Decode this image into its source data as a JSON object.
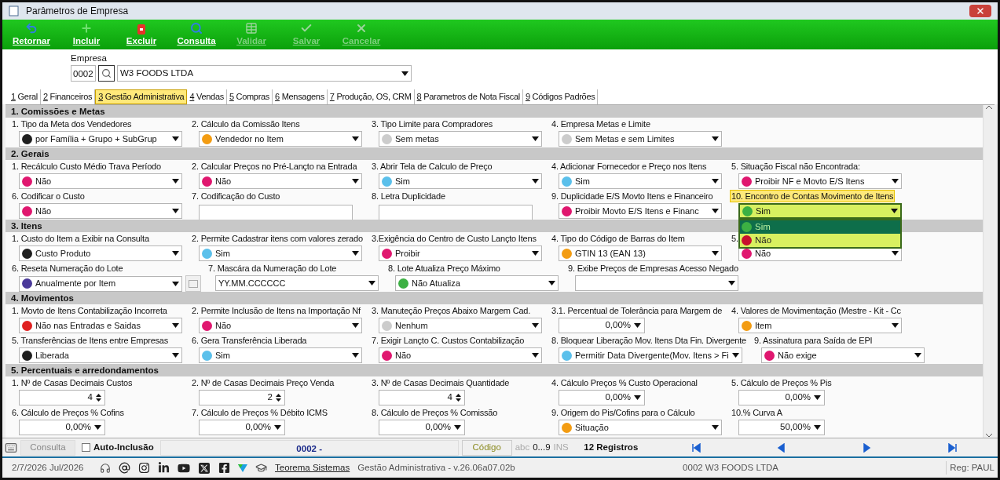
{
  "window": {
    "title": "Parâmetros de Empresa"
  },
  "toolbar": [
    {
      "label": "Retornar",
      "disabled": false
    },
    {
      "label": "Incluir",
      "disabled": false
    },
    {
      "label": "Excluir",
      "disabled": false
    },
    {
      "label": "Consulta",
      "disabled": false
    },
    {
      "label": "Validar",
      "disabled": true
    },
    {
      "label": "Salvar",
      "disabled": true
    },
    {
      "label": "Cancelar",
      "disabled": true
    }
  ],
  "empresa": {
    "label": "Empresa",
    "code": "0002",
    "name": "W3 FOODS LTDA"
  },
  "tabs": [
    {
      "key": "1",
      "label": "Geral",
      "selected": false
    },
    {
      "key": "2",
      "label": "Financeiros",
      "selected": false
    },
    {
      "key": "3",
      "label": "Gestão Administrativa",
      "selected": true
    },
    {
      "key": "4",
      "label": "Vendas",
      "selected": false
    },
    {
      "key": "5",
      "label": "Compras",
      "selected": false
    },
    {
      "key": "6",
      "label": "Mensagens",
      "selected": false
    },
    {
      "key": "7",
      "label": "Produção, OS, CRM",
      "selected": false
    },
    {
      "key": "8",
      "label": "Parametros de Nota Fiscal",
      "selected": false
    },
    {
      "key": "9",
      "label": "Códigos Padrões",
      "selected": false
    }
  ],
  "sections": [
    {
      "title": "1.  Comissões e Metas",
      "rows": [
        [
          {
            "label": "1. Tipo da Meta dos Vendedores",
            "kind": "combo",
            "value": "por Família + Grupo + SubGrup",
            "color": "#1f1f1f"
          },
          {
            "label": "2. Cálculo da Comissão Itens",
            "kind": "combo",
            "value": "Vendedor no Item",
            "color": "#f39c12"
          },
          {
            "label": "3. Tipo Limite para Compradores",
            "kind": "combo",
            "value": "Sem metas",
            "color": "#cccccc"
          },
          {
            "label": "4. Empresa Metas e Limite",
            "kind": "combo",
            "value": "Sem Metas e sem Limites",
            "color": "#cccccc"
          }
        ]
      ]
    },
    {
      "title": "2. Gerais",
      "rows": [
        [
          {
            "label": "1. Recálculo Custo Médio Trava Período",
            "kind": "combo",
            "value": "Não",
            "color": "#e0176f"
          },
          {
            "label": "2. Calcular Preços no Pré-Lançto na Entrada",
            "kind": "combo",
            "value": "Não",
            "color": "#e0176f"
          },
          {
            "label": "3. Abrir Tela de Calculo de Preço",
            "kind": "combo",
            "value": "Sim",
            "color": "#5bc0eb"
          },
          {
            "label": "4. Adicionar Fornecedor e Preço nos Itens",
            "kind": "combo",
            "value": "Sim",
            "color": "#5bc0eb"
          },
          {
            "label": "5. Situação Fiscal não Encontrada:",
            "kind": "combo",
            "value": "Proibir NF e Movto E/S Itens",
            "color": "#e0176f"
          }
        ],
        [
          {
            "label": "6. Codificar o Custo",
            "kind": "combo",
            "value": "Não",
            "color": "#e0176f"
          },
          {
            "label": "7. Codificação do Custo",
            "kind": "text"
          },
          {
            "label": "8. Letra Duplicidade",
            "kind": "text"
          },
          {
            "label": "9. Duplicidade E/S Movto Itens e Financeiro",
            "kind": "combo",
            "value": "Proibir Movto E/S Itens e Financ",
            "color": "#e0176f"
          },
          {
            "label": "10. Encontro de Contas Movimento de Itens",
            "kind": "combo",
            "value": "Sim",
            "color": "#3cb043",
            "highlighted": true,
            "open": true,
            "options": [
              {
                "label": "Sim",
                "color": "#3cb043",
                "selected": true
              },
              {
                "label": "Não",
                "color": "#c8102e",
                "selected": false
              }
            ]
          }
        ]
      ]
    },
    {
      "title": "3. Itens",
      "rows": [
        [
          {
            "label": "1. Custo do Item a Exibir na Consulta",
            "kind": "combo",
            "value": "Custo Produto",
            "color": "#1f1f1f"
          },
          {
            "label": "2. Permite Cadastrar itens com valores zerado",
            "kind": "combo",
            "value": "Sim",
            "color": "#5bc0eb"
          },
          {
            "label": "3.Exigência do Centro de Custo Lançto Itens",
            "kind": "combo",
            "value": "Proibir",
            "color": "#e0176f"
          },
          {
            "label": "4. Tipo do Código de Barras do Item",
            "kind": "combo",
            "value": "GTIN 13 (EAN 13)",
            "color": "#f39c12"
          },
          {
            "label": "5.",
            "kind": "combo",
            "value": "Não",
            "color": "#e0176f"
          }
        ],
        [
          {
            "label": "6. Reseta Numeração do Lote",
            "kind": "combo",
            "value": "Anualmente por Item",
            "color": "#4b3a9a",
            "side_button": true
          },
          {
            "label": "7. Mascára da Numeração do Lote",
            "kind": "combo",
            "value": "YY.MM.CCCCCC"
          },
          {
            "label": "8. Lote Atualiza Preço Máximo",
            "kind": "combo",
            "value": "Não Atualiza",
            "color": "#3cb043"
          },
          {
            "label": "9. Exibe Preços de Empresas Acesso Negado",
            "kind": "combo"
          }
        ]
      ]
    },
    {
      "title": "4. Movimentos",
      "rows": [
        [
          {
            "label": "1. Movto de Itens Contabilização Incorreta",
            "kind": "combo",
            "value": "Não nas Entradas e Saidas",
            "color": "#e02020"
          },
          {
            "label": "2. Permite Inclusão de Itens na Importação Nf",
            "kind": "combo",
            "value": "Não",
            "color": "#e0176f"
          },
          {
            "label": "3. Manuteção Preços Abaixo  Margem Cad.",
            "kind": "combo",
            "value": "Nenhum",
            "color": "#cccccc"
          },
          {
            "label": "3.1. Percentual de Tolerância para Margem de",
            "kind": "percent",
            "value": "0,00%"
          },
          {
            "label": "4. Valores de Movimentação (Mestre - Kit - Cc",
            "kind": "combo",
            "value": "Item",
            "color": "#f39c12"
          }
        ],
        [
          {
            "label": "5. Transferências  de Itens entre Empresas",
            "kind": "combo",
            "value": "Liberada",
            "color": "#1f1f1f"
          },
          {
            "label": "6. Gera Transferência Liberada",
            "kind": "combo",
            "value": "Sim",
            "color": "#5bc0eb"
          },
          {
            "label": "7. Exigir Lançto C. Custos Contabilização",
            "kind": "combo",
            "value": "Não",
            "color": "#e0176f"
          },
          {
            "label": "8. Bloquear Liberação Mov. Itens Dta Fin. Divergente",
            "kind": "combo",
            "value": "Permitir Data Divergente(Mov. Itens > Fi",
            "color": "#5bc0eb"
          },
          {
            "label": "9. Assinatura para Saída de EPI",
            "kind": "combo",
            "value": "Não exige",
            "color": "#e0176f"
          }
        ]
      ]
    },
    {
      "title": "5. Percentuais e arredondamentos",
      "rows": [
        [
          {
            "label": "1. Nº de Casas Decimais Custos",
            "kind": "spin",
            "value": "4"
          },
          {
            "label": "2. Nº de Casas Decimais Preço Venda",
            "kind": "spin",
            "value": "2"
          },
          {
            "label": "3. Nº de Casas Decimais Quantidade",
            "kind": "spin",
            "value": "4"
          },
          {
            "label": "4. Cálculo Preços % Custo Operacional",
            "kind": "percent",
            "value": "0,00%"
          },
          {
            "label": "5. Cálculo de Preços % Pis",
            "kind": "percent",
            "value": "0,00%"
          }
        ],
        [
          {
            "label": "6. Cálculo de Preços % Cofins",
            "kind": "percent",
            "value": "0,00%"
          },
          {
            "label": "7. Cálculo de Preços % Débito ICMS",
            "kind": "percent",
            "value": "0,00%"
          },
          {
            "label": "8. Cálculo de Preços % Comissão",
            "kind": "percent",
            "value": "0,00%"
          },
          {
            "label": "9. Origem do Pis/Cofins para o Cálculo",
            "kind": "combo",
            "value": "Situação",
            "color": "#f39c12"
          },
          {
            "label": "10.% Curva A",
            "kind": "percent",
            "value": "50,00%"
          }
        ]
      ]
    }
  ],
  "status_bar": {
    "mode": "Consulta",
    "auto_inclusao": {
      "label": "Auto-Inclusão",
      "checked": false
    },
    "record": "0002 -",
    "codigo": "Código",
    "abc": "abc",
    "digits": "0...9",
    "ins": "INS",
    "count": "12 Registros"
  },
  "footer": {
    "date": "2/7/2026 Jul/2026",
    "link": "Teorema Sistemas",
    "version": "Gestão Administrativa - v.26.06a07.02b",
    "company": "0002 W3 FOODS LTDA",
    "user": "Reg: PAUL"
  }
}
